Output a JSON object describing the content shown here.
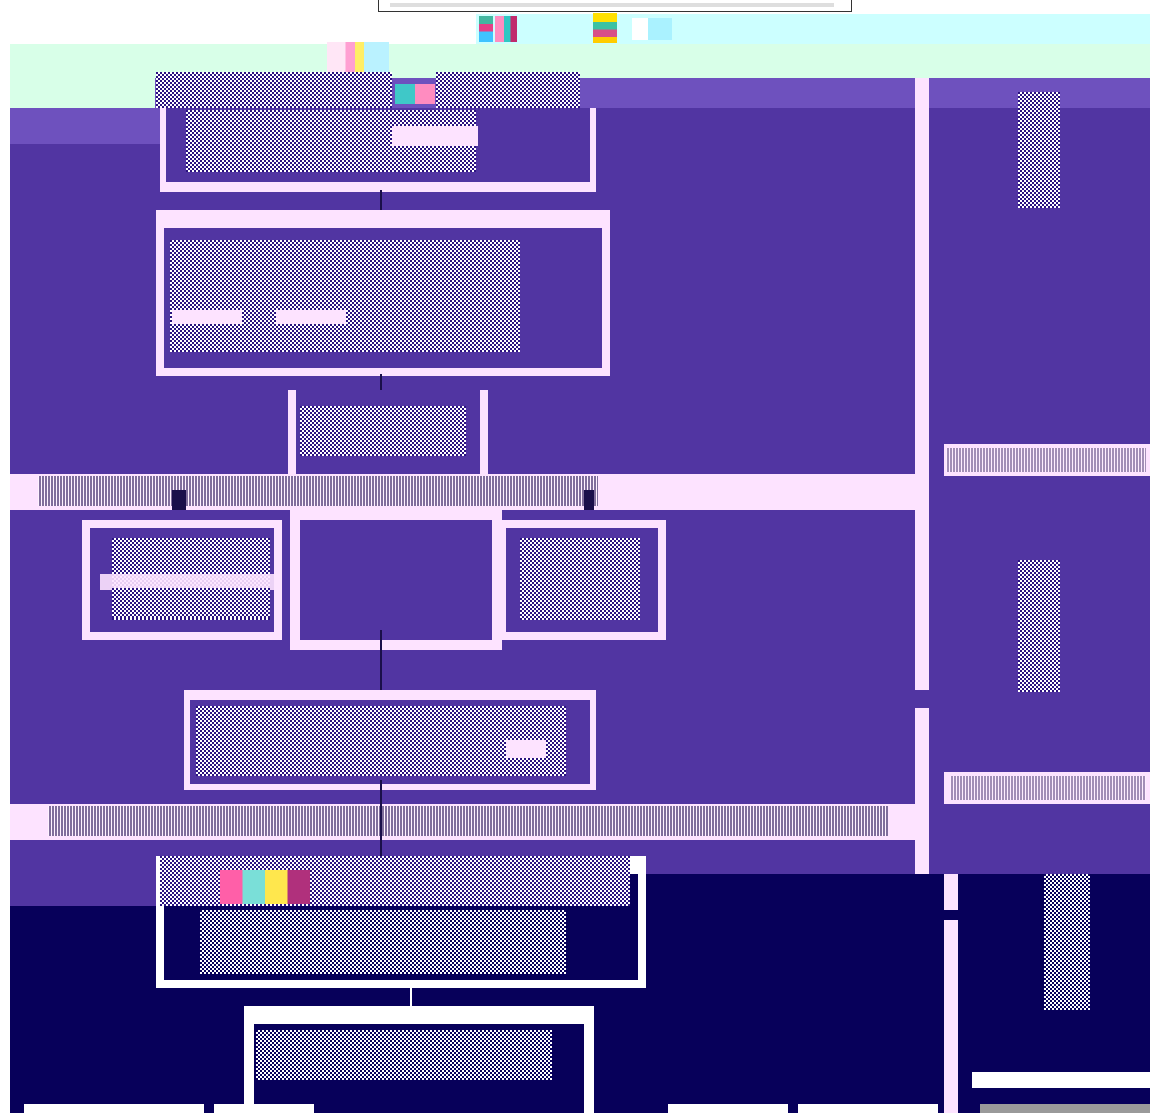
{
  "screen": {
    "state": "corrupted-render",
    "colors": {
      "top_white": "#ffffff",
      "top_cyan": "#ccffff",
      "mint_band": "#d8ffe8",
      "purple_main": "#5135a2",
      "purple_light": "#6e51be",
      "pink_band": "#fde3ff",
      "navy_block": "#07005a",
      "line_dark": "#1a0f4a",
      "lavender_line": "#fde3ff"
    }
  }
}
